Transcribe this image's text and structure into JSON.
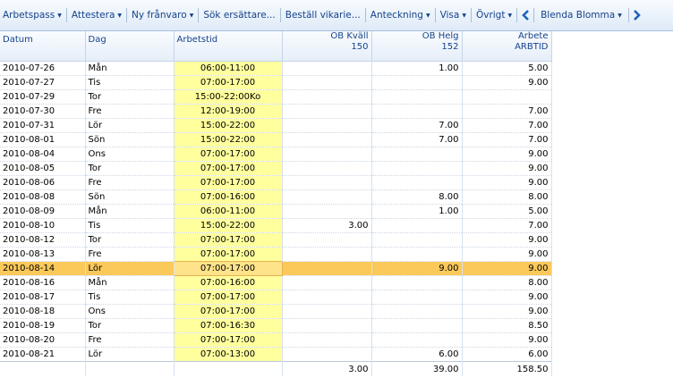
{
  "toolbar": {
    "items": [
      {
        "label": "Arbetspass",
        "dropdown": true
      },
      {
        "label": "Attestera",
        "dropdown": true
      },
      {
        "label": "Ny frånvaro",
        "dropdown": true
      },
      {
        "label": "Sök ersättare...",
        "dropdown": false
      },
      {
        "label": "Beställ vikarie...",
        "dropdown": false
      },
      {
        "label": "Anteckning",
        "dropdown": true
      },
      {
        "label": "Visa",
        "dropdown": true
      },
      {
        "label": "Övrigt",
        "dropdown": true
      }
    ],
    "person": "Blenda Blomma"
  },
  "grid": {
    "columns": {
      "datum": "Datum",
      "dag": "Dag",
      "arbetstid": "Arbetstid",
      "ob_kvall": "OB Kväll",
      "ob_kvall_code": "150",
      "ob_helg": "OB Helg",
      "ob_helg_code": "152",
      "arbete": "Arbete",
      "arbete_code": "ARBTID"
    },
    "rows": [
      [
        "2010-07-26",
        "Mån",
        "06:00-11:00",
        "",
        "1.00",
        "5.00"
      ],
      [
        "2010-07-27",
        "Tis",
        "07:00-17:00",
        "",
        "",
        "9.00"
      ],
      [
        "2010-07-29",
        "Tor",
        "15:00-22:00Ko",
        "",
        "",
        ""
      ],
      [
        "2010-07-30",
        "Fre",
        "12:00-19:00",
        "",
        "",
        "7.00"
      ],
      [
        "2010-07-31",
        "Lör",
        "15:00-22:00",
        "",
        "7.00",
        "7.00"
      ],
      [
        "2010-08-01",
        "Sön",
        "15:00-22:00",
        "",
        "7.00",
        "7.00"
      ],
      [
        "2010-08-04",
        "Ons",
        "07:00-17:00",
        "",
        "",
        "9.00"
      ],
      [
        "2010-08-05",
        "Tor",
        "07:00-17:00",
        "",
        "",
        "9.00"
      ],
      [
        "2010-08-06",
        "Fre",
        "07:00-17:00",
        "",
        "",
        "9.00"
      ],
      [
        "2010-08-08",
        "Sön",
        "07:00-16:00",
        "",
        "8.00",
        "8.00"
      ],
      [
        "2010-08-09",
        "Mån",
        "06:00-11:00",
        "",
        "1.00",
        "5.00"
      ],
      [
        "2010-08-10",
        "Tis",
        "15:00-22:00",
        "3.00",
        "",
        "7.00"
      ],
      [
        "2010-08-12",
        "Tor",
        "07:00-17:00",
        "",
        "",
        "9.00"
      ],
      [
        "2010-08-13",
        "Fre",
        "07:00-17:00",
        "",
        "",
        "9.00"
      ],
      [
        "2010-08-14",
        "Lör",
        "07:00-17:00",
        "",
        "9.00",
        "9.00"
      ],
      [
        "2010-08-16",
        "Mån",
        "07:00-16:00",
        "",
        "",
        "8.00"
      ],
      [
        "2010-08-17",
        "Tis",
        "07:00-17:00",
        "",
        "",
        "9.00"
      ],
      [
        "2010-08-18",
        "Ons",
        "07:00-17:00",
        "",
        "",
        "9.00"
      ],
      [
        "2010-08-19",
        "Tor",
        "07:00-16:30",
        "",
        "",
        "8.50"
      ],
      [
        "2010-08-20",
        "Fre",
        "07:00-17:00",
        "",
        "",
        "9.00"
      ],
      [
        "2010-08-21",
        "Lör",
        "07:00-13:00",
        "",
        "6.00",
        "6.00"
      ]
    ],
    "selected_date": "2010-08-14",
    "totals": {
      "ob_kvall": "3.00",
      "ob_helg": "39.00",
      "arbete": "158.50"
    }
  },
  "colors": {
    "shift_bg": "#ffff9e",
    "selected_row": "#fbc95a",
    "toolbar_text": "#15428b"
  }
}
